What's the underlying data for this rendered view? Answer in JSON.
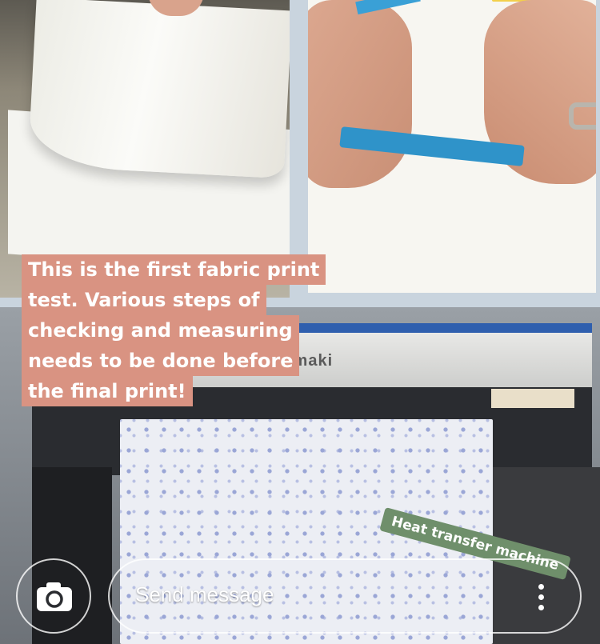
{
  "story": {
    "caption_lines": [
      "This is the first fabric print",
      "test. Various steps of",
      "checking and measuring",
      "needs to be done before",
      "the final print!"
    ],
    "sticker_text": "Heat transfer machine",
    "printer_brand_partial": "imaki"
  },
  "composer": {
    "camera_icon": "camera-icon",
    "message_placeholder": "Send message",
    "more_icon": "more-vertical-icon"
  },
  "colors": {
    "caption_bg": "#d99382",
    "sticker_bg": "#6f8f6b",
    "frame_bg": "#c9d4de"
  }
}
